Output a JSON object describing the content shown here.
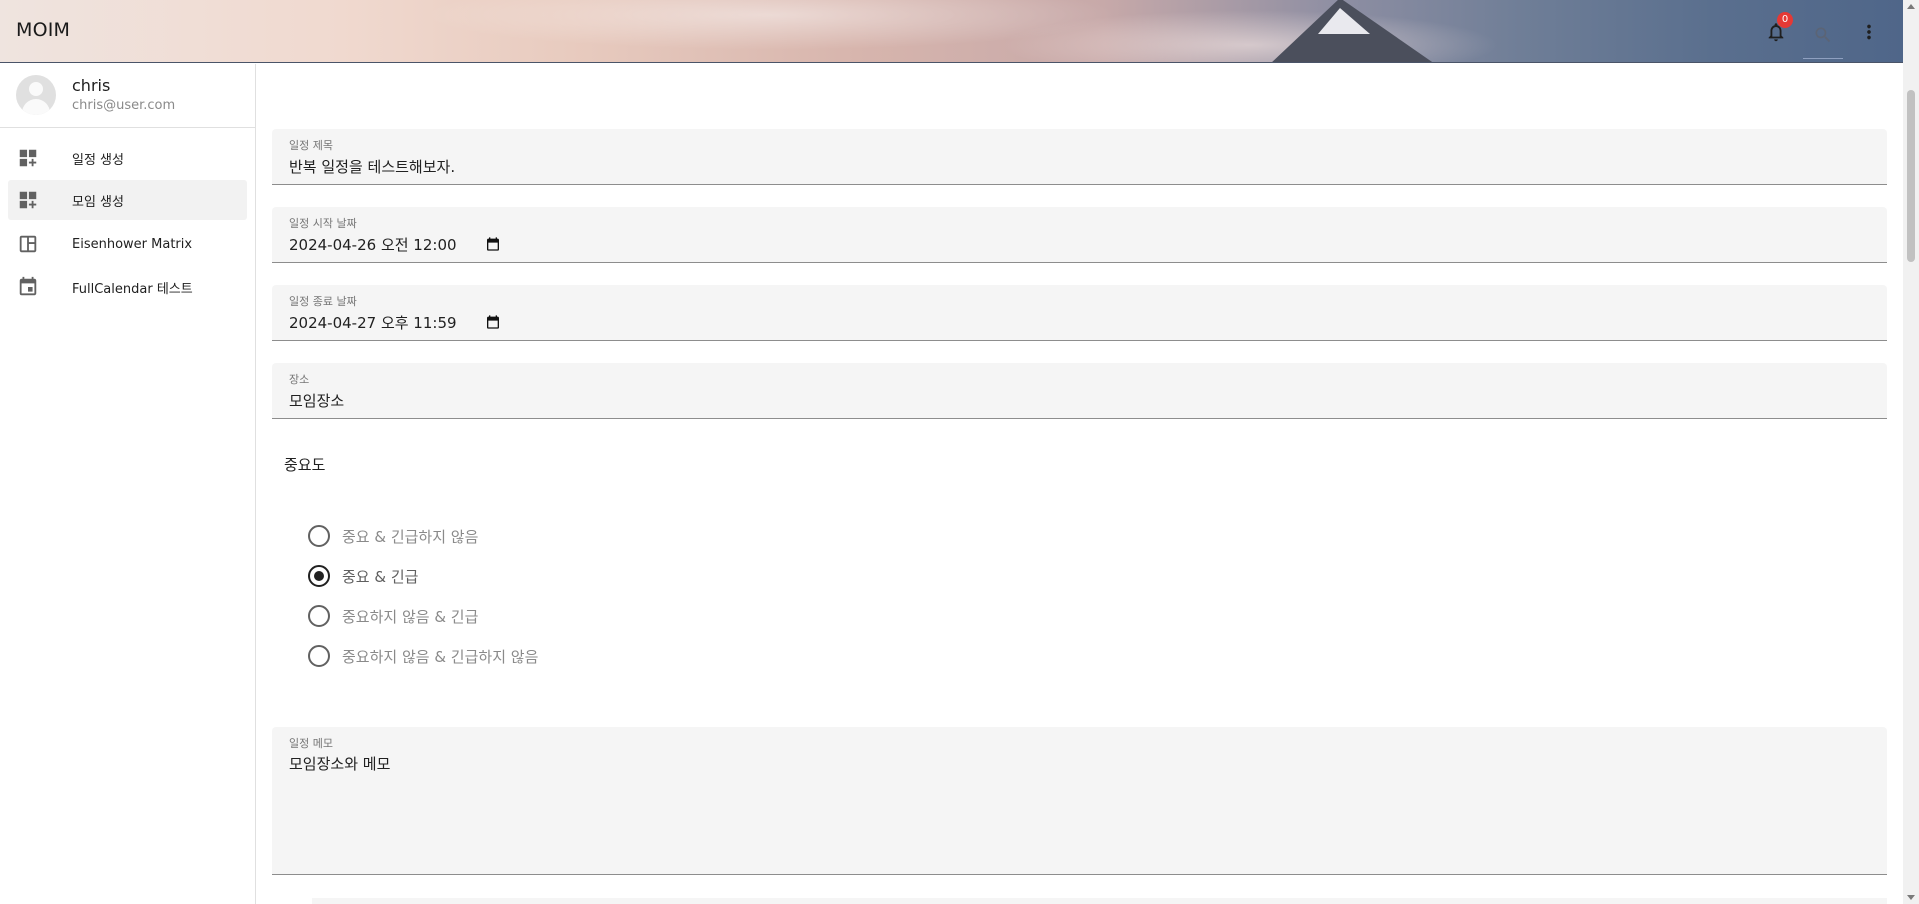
{
  "app": {
    "title": "MOIM"
  },
  "header": {
    "notification_count": "0",
    "icons": [
      "bell-icon",
      "search-icon",
      "more-vert-icon"
    ]
  },
  "sidebar": {
    "user": {
      "name": "chris",
      "email": "chris@user.com"
    },
    "items": [
      {
        "label": "일정 생성",
        "icon": "dashboard-customize-icon",
        "active": false
      },
      {
        "label": "모임 생성",
        "icon": "dashboard-customize-icon",
        "active": true
      },
      {
        "label": "Eisenhower Matrix",
        "icon": "view-quilt-icon",
        "active": false
      },
      {
        "label": "FullCalendar 테스트",
        "icon": "calendar-icon",
        "active": false
      }
    ]
  },
  "form": {
    "title": {
      "label": "일정 제목",
      "value": "반복 일정을 테스트해보자."
    },
    "start_date": {
      "label": "일정 시작 날짜",
      "value": "2024-04-26 오전 12:00"
    },
    "end_date": {
      "label": "일정 종료 날짜",
      "value": "2024-04-27 오후 11:59"
    },
    "location": {
      "label": "장소",
      "value": "모임장소"
    },
    "importance": {
      "title": "중요도",
      "options": [
        "중요 & 긴급하지 않음",
        "중요 & 긴급",
        "중요하지 않음 & 긴급",
        "중요하지 않음 & 긴급하지 않음"
      ],
      "selected": "중요 & 긴급"
    },
    "memo": {
      "label": "일정 메모",
      "value": "모임장소와 메모"
    }
  }
}
